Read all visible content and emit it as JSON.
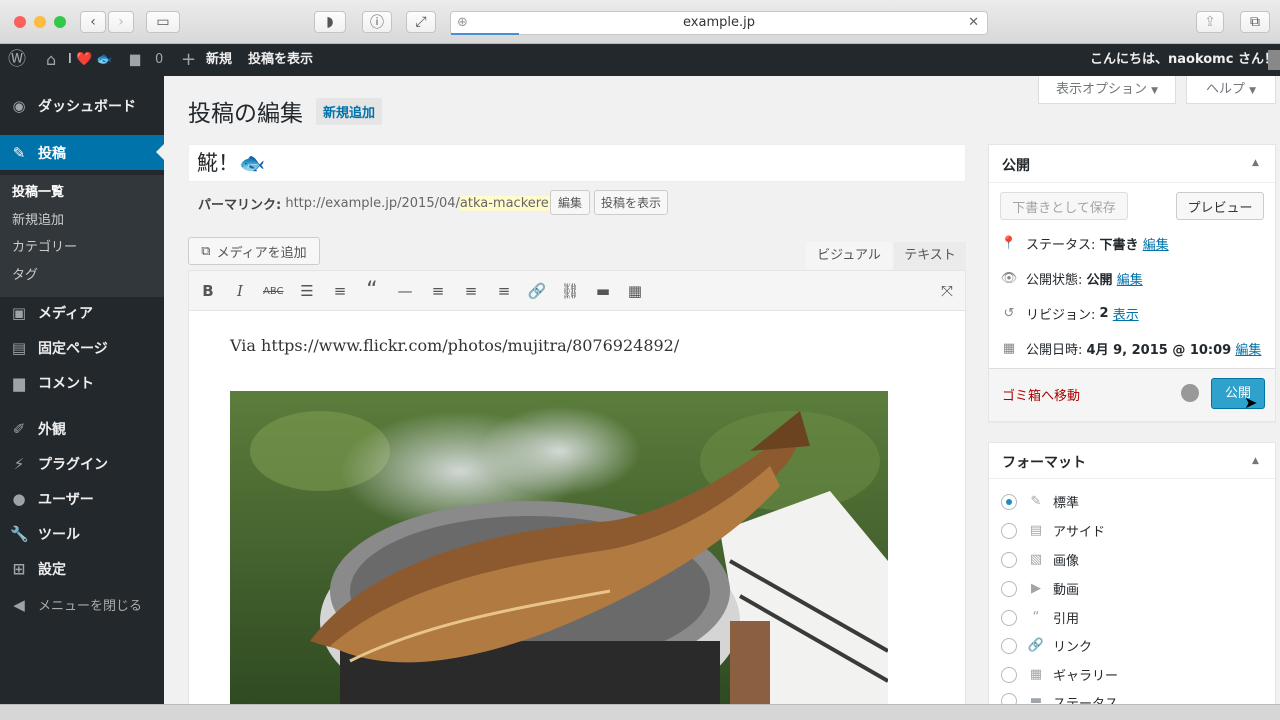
{
  "browser": {
    "url": "example.jp"
  },
  "adminbar": {
    "site": "I ❤️ 🐟",
    "comments_count": "0",
    "new_label": "新規",
    "view_post": "投稿を表示",
    "greeting": "こんにちは、naokomc さん！"
  },
  "sidebar": {
    "items": [
      {
        "label": "ダッシュボード",
        "icon": "dashboard-icon"
      },
      {
        "label": "投稿",
        "icon": "pin-icon"
      },
      {
        "label": "メディア",
        "icon": "media-icon"
      },
      {
        "label": "固定ページ",
        "icon": "page-icon"
      },
      {
        "label": "コメント",
        "icon": "comment-icon"
      },
      {
        "label": "外観",
        "icon": "appearance-icon"
      },
      {
        "label": "プラグイン",
        "icon": "plugin-icon"
      },
      {
        "label": "ユーザー",
        "icon": "user-icon"
      },
      {
        "label": "ツール",
        "icon": "wrench-icon"
      },
      {
        "label": "設定",
        "icon": "settings-icon"
      }
    ],
    "sub": [
      "投稿一覧",
      "新規追加",
      "カテゴリー",
      "タグ"
    ],
    "collapse": "メニューを閉じる"
  },
  "screen_options": "表示オプション",
  "help": "ヘルプ",
  "page_title": "投稿の編集",
  "add_new": "新規追加",
  "post_title": "𩸽！🐟",
  "permalink": {
    "label": "パーマリンク:",
    "base": "http://example.jp/2015/04/",
    "slug": "atka-mackerel",
    "trail": "/",
    "edit": "編集",
    "view": "投稿を表示"
  },
  "add_media": "メディアを追加",
  "tabs": {
    "visual": "ビジュアル",
    "text": "テキスト"
  },
  "content": {
    "via": "Via https://www.flickr.com/photos/mujitra/8076924892/"
  },
  "publish_box": {
    "title": "公開",
    "save_draft": "下書きとして保存",
    "preview": "プレビュー",
    "status_label": "ステータス:",
    "status_value": "下書き",
    "visibility_label": "公開状態:",
    "visibility_value": "公開",
    "revisions_label": "リビジョン:",
    "revisions_value": "2",
    "revisions_link": "表示",
    "date_label": "公開日時:",
    "date_value": "4月 9, 2015 @ 10:09",
    "edit": "編集",
    "trash": "ゴミ箱へ移動",
    "publish": "公開"
  },
  "format_box": {
    "title": "フォーマット",
    "options": [
      "標準",
      "アサイド",
      "画像",
      "動画",
      "引用",
      "リンク",
      "ギャラリー",
      "ステータス"
    ],
    "selected": 0
  },
  "colors": {
    "admin_dark": "#23282d",
    "accent": "#0073aa",
    "publish": "#2ea2cc",
    "trash": "#a00"
  }
}
